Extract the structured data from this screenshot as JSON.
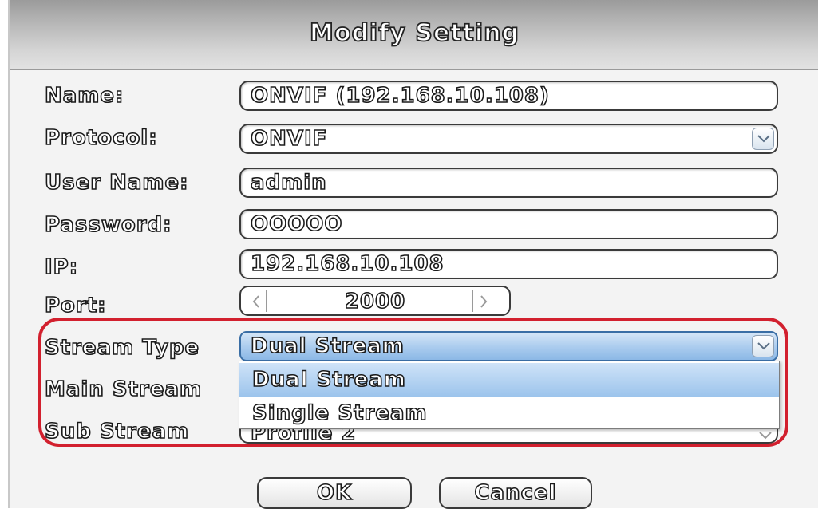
{
  "window": {
    "title": "Modify Setting"
  },
  "form": {
    "name_label": "Name:",
    "name_value": "ONVIF (192.168.10.108)",
    "protocol_label": "Protocol:",
    "protocol_value": "ONVIF",
    "username_label": "User Name:",
    "username_value": "admin",
    "password_label": "Password:",
    "password_value": "OOOOO",
    "ip_label": "IP:",
    "ip_value": "192.168.10.108",
    "port_label": "Port:",
    "port_value": "2000",
    "stream_type_label": "Stream Type",
    "stream_type_value": "Dual Stream",
    "main_stream_label": "Main Stream",
    "sub_stream_label": "Sub Stream",
    "sub_stream_value": "Profile 2"
  },
  "dropdown": {
    "options": [
      "Dual Stream",
      "Single Stream"
    ],
    "selected": "Dual Stream"
  },
  "buttons": {
    "ok": "OK",
    "cancel": "Cancel"
  },
  "colors": {
    "highlight": "#d2202e",
    "selection": "#9cc4ec"
  },
  "icons": {
    "dropdown": "chevron-down-icon",
    "decrement": "chevron-left-icon",
    "increment": "chevron-right-icon"
  }
}
